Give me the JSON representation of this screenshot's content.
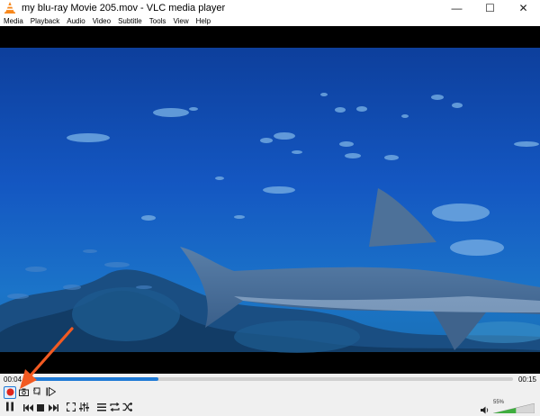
{
  "window": {
    "title": "my blu-ray Movie 205.mov - VLC media player",
    "minimize": "—",
    "maximize": "☐",
    "close": "✕"
  },
  "menu": [
    "Media",
    "Playback",
    "Audio",
    "Video",
    "Subtitle",
    "Tools",
    "View",
    "Help"
  ],
  "playback": {
    "current_time": "00:04",
    "total_time": "00:15",
    "progress": 0.27
  },
  "volume": {
    "label": "55%",
    "level": 0.55
  },
  "colors": {
    "accent": "#1f7ad6",
    "record": "#e0241b",
    "annotation_arrow": "#f25a22"
  },
  "icons": {
    "row1": [
      "record-icon",
      "snapshot-icon",
      "loop-ab-icon",
      "frame-step-icon"
    ],
    "row2": [
      "pause-icon",
      "previous-icon",
      "stop-icon",
      "next-icon",
      "fullscreen-icon",
      "extended-settings-icon",
      "playlist-icon",
      "loop-icon",
      "shuffle-icon",
      "speaker-icon"
    ]
  }
}
